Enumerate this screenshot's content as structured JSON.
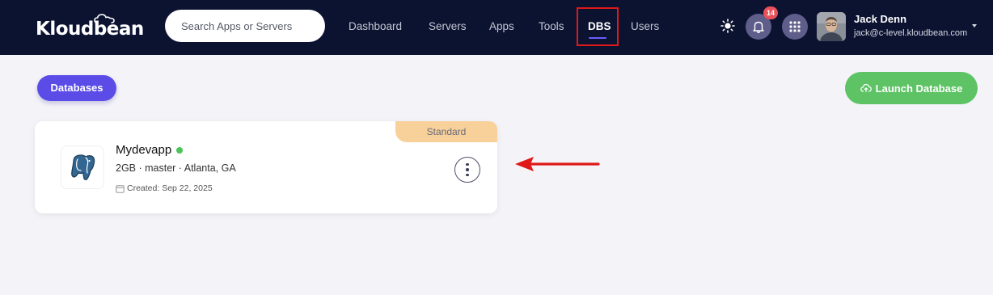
{
  "header": {
    "logo_text": "Kloudbean",
    "search": {
      "placeholder": "Search Apps or Servers",
      "value": ""
    },
    "nav": [
      {
        "label": "Dashboard",
        "active": false
      },
      {
        "label": "Servers",
        "active": false
      },
      {
        "label": "Apps",
        "active": false
      },
      {
        "label": "Tools",
        "active": false
      },
      {
        "label": "DBS",
        "active": true
      },
      {
        "label": "Users",
        "active": false
      }
    ],
    "notifications_count": "14",
    "user": {
      "name": "Jack Denn",
      "email": "jack@c-level.kloudbean.com"
    },
    "icons": {
      "theme": "sun-icon",
      "notifications": "bell-icon",
      "apps": "grid-icon",
      "menu": "chevron-down-icon"
    }
  },
  "toolbar": {
    "tab_label": "Databases",
    "launch_label": "Launch Database",
    "launch_icon": "cloud-upload-icon"
  },
  "database_card": {
    "plan": "Standard",
    "name": "Mydevapp",
    "status": "online",
    "details": "2GB · master · Atlanta, GA",
    "created": "Created: Sep 22, 2025",
    "engine_icon": "postgresql-icon"
  },
  "colors": {
    "topbar": "#0c1331",
    "accent": "#5b4ce8",
    "launch": "#5dc364",
    "plan_badge": "#f7d09a",
    "status_online": "#4cc45a",
    "annotation": "#e01818"
  }
}
